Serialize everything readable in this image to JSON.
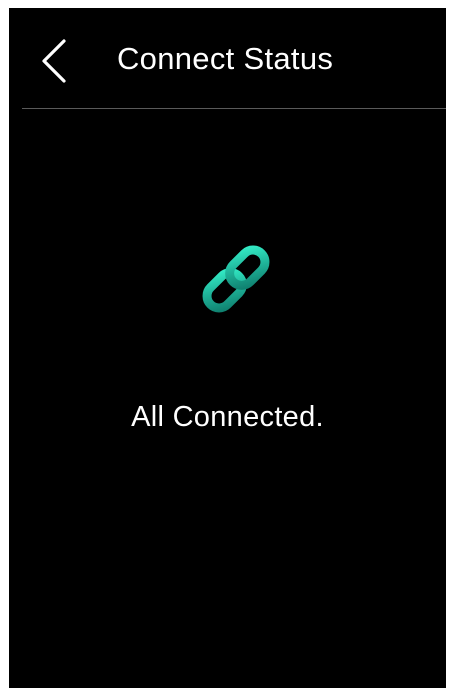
{
  "header": {
    "title": "Connect Status",
    "back_icon": "chevron-left-icon"
  },
  "status": {
    "icon": "link-chain-icon",
    "message": "All Connected."
  },
  "colors": {
    "background": "#000000",
    "text": "#ffffff",
    "divider": "#5a5a5a",
    "accent_light": "#2ee6c0",
    "accent_dark": "#128a76"
  }
}
